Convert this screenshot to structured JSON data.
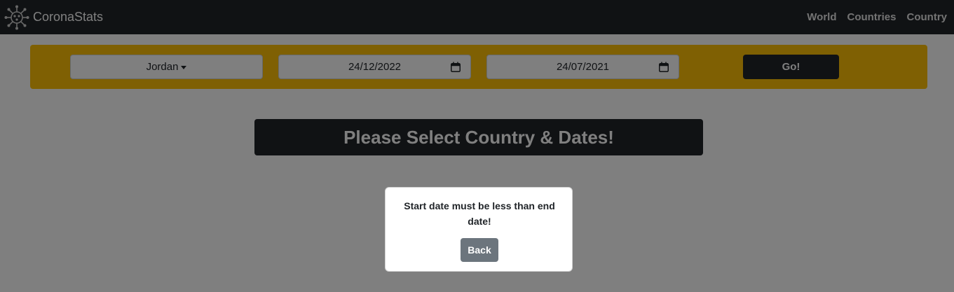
{
  "navbar": {
    "brand": "CoronaStats",
    "logo_icon": "virus-icon",
    "links": [
      "World",
      "Countries",
      "Country"
    ]
  },
  "form": {
    "country": "Jordan",
    "start_date": "24/12/2022",
    "end_date": "24/07/2021",
    "go_label": "Go!",
    "calendar_icon": "calendar-icon"
  },
  "banner": {
    "title": "Please Select Country & Dates!"
  },
  "modal": {
    "message": "Start date must be less than end date!",
    "back_label": "Back"
  },
  "colors": {
    "navbar_bg": "#212529",
    "form_bg": "#ffc107",
    "banner_bg": "#212529",
    "back_button_bg": "#6c757d"
  }
}
